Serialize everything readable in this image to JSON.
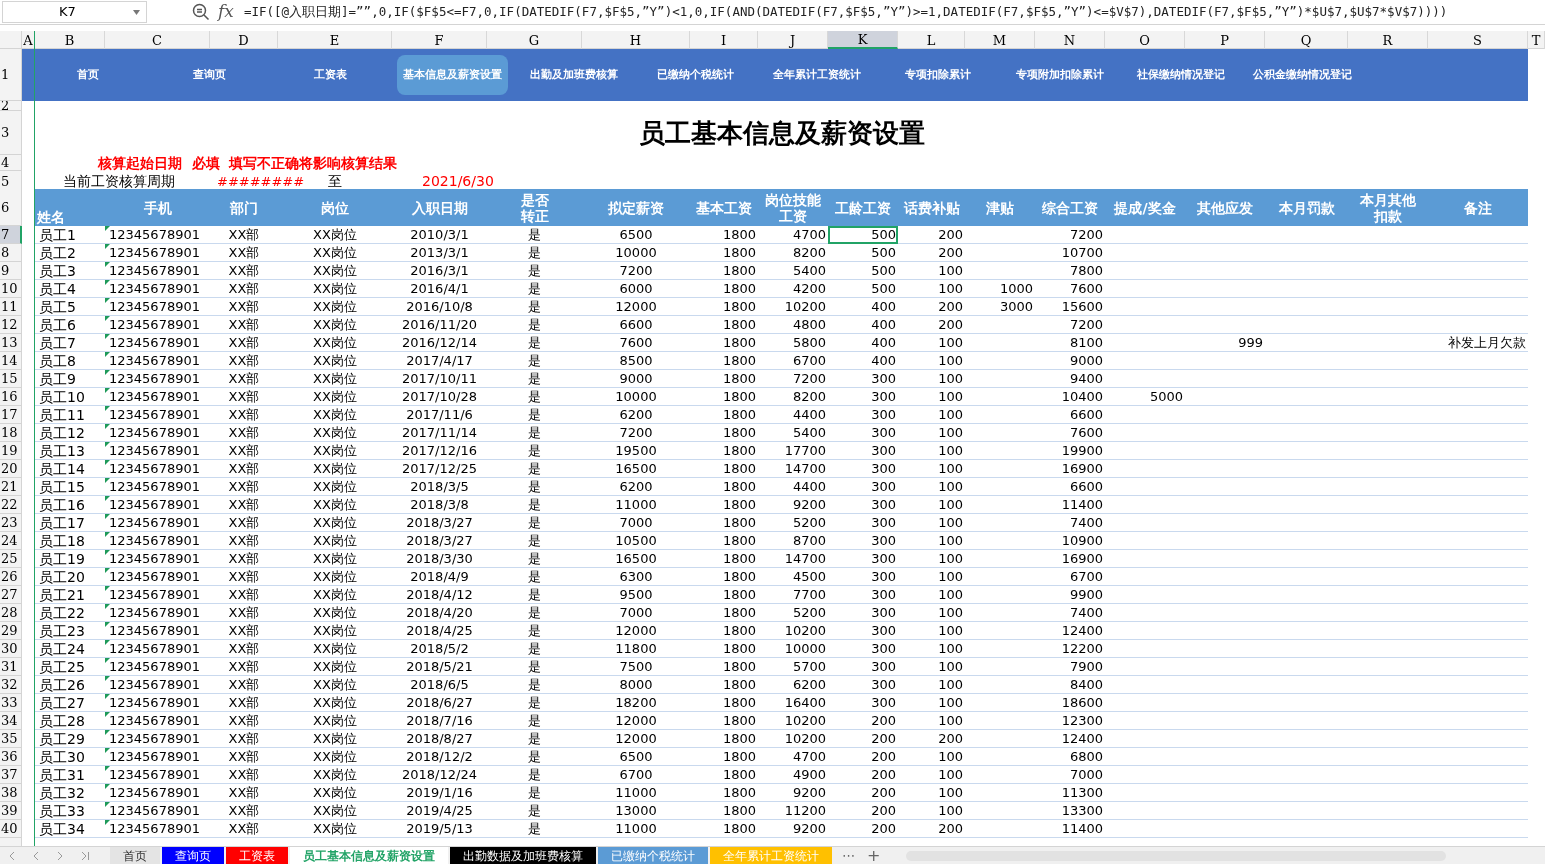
{
  "formula_bar": {
    "name_box": "K7",
    "fx_label": "fx",
    "formula": "=IF([@入职日期]=””,0,IF($F$5<=F7,0,IF(DATEDIF(F7,$F$5,”Y”)<1,0,IF(AND(DATEDIF(F7,$F$5,”Y”)>=1,DATEDIF(F7,$F$5,”Y”)<=$V$7),DATEDIF(F7,$F$5,”Y”)*$U$7,$U$7*$V$7))))"
  },
  "column_headers": [
    {
      "label": "A",
      "selected": false
    },
    {
      "label": "B",
      "selected": false
    },
    {
      "label": "C",
      "selected": false
    },
    {
      "label": "D",
      "selected": false
    },
    {
      "label": "E",
      "selected": false
    },
    {
      "label": "F",
      "selected": false
    },
    {
      "label": "G",
      "selected": false
    },
    {
      "label": "H",
      "selected": false
    },
    {
      "label": "I",
      "selected": false
    },
    {
      "label": "J",
      "selected": false
    },
    {
      "label": "K",
      "selected": true
    },
    {
      "label": "L",
      "selected": false
    },
    {
      "label": "M",
      "selected": false
    },
    {
      "label": "N",
      "selected": false
    },
    {
      "label": "O",
      "selected": false
    },
    {
      "label": "P",
      "selected": false
    },
    {
      "label": "Q",
      "selected": false
    },
    {
      "label": "R",
      "selected": false
    },
    {
      "label": "S",
      "selected": false
    },
    {
      "label": "T",
      "selected": false
    }
  ],
  "row_numbers": [
    {
      "label": "1",
      "selected": false
    },
    {
      "label": "2",
      "selected": false
    },
    {
      "label": "3",
      "selected": false
    },
    {
      "label": "4",
      "selected": false
    },
    {
      "label": "5",
      "selected": false
    },
    {
      "label": "6",
      "selected": false
    },
    {
      "label": "7",
      "selected": true
    },
    {
      "label": "8",
      "selected": false
    },
    {
      "label": "9",
      "selected": false
    },
    {
      "label": "10",
      "selected": false
    },
    {
      "label": "11",
      "selected": false
    },
    {
      "label": "12",
      "selected": false
    },
    {
      "label": "13",
      "selected": false
    },
    {
      "label": "14",
      "selected": false
    },
    {
      "label": "15",
      "selected": false
    },
    {
      "label": "16",
      "selected": false
    },
    {
      "label": "17",
      "selected": false
    },
    {
      "label": "18",
      "selected": false
    },
    {
      "label": "19",
      "selected": false
    },
    {
      "label": "20",
      "selected": false
    },
    {
      "label": "21",
      "selected": false
    },
    {
      "label": "22",
      "selected": false
    },
    {
      "label": "23",
      "selected": false
    },
    {
      "label": "24",
      "selected": false
    },
    {
      "label": "25",
      "selected": false
    },
    {
      "label": "26",
      "selected": false
    },
    {
      "label": "27",
      "selected": false
    },
    {
      "label": "28",
      "selected": false
    },
    {
      "label": "29",
      "selected": false
    },
    {
      "label": "30",
      "selected": false
    },
    {
      "label": "31",
      "selected": false
    },
    {
      "label": "32",
      "selected": false
    },
    {
      "label": "33",
      "selected": false
    },
    {
      "label": "34",
      "selected": false
    },
    {
      "label": "35",
      "selected": false
    },
    {
      "label": "36",
      "selected": false
    },
    {
      "label": "37",
      "selected": false
    },
    {
      "label": "38",
      "selected": false
    },
    {
      "label": "39",
      "selected": false
    },
    {
      "label": "40",
      "selected": false
    }
  ],
  "nav_buttons": [
    {
      "label": "首页",
      "selected": false
    },
    {
      "label": "查询页",
      "selected": false
    },
    {
      "label": "工资表",
      "selected": false
    },
    {
      "label": "基本信息及薪资设置",
      "selected": true
    },
    {
      "label": "出勤及加班费核算",
      "selected": false
    },
    {
      "label": "已缴纳个税统计",
      "selected": false
    },
    {
      "label": "全年累计工资统计",
      "selected": false
    },
    {
      "label": "专项扣除累计",
      "selected": false
    },
    {
      "label": "专项附加扣除累计",
      "selected": false
    },
    {
      "label": "社保缴纳情况登记",
      "selected": false
    },
    {
      "label": "公积金缴纳情况登记",
      "selected": false
    }
  ],
  "title": "员工基本信息及薪资设置",
  "notice": "核算起始日期  必填  填写不正确将影响核算结果",
  "period": {
    "label": "当前工资核算周期",
    "start": "########",
    "separator": "至",
    "end": "2021/6/30"
  },
  "table": {
    "columns": [
      {
        "label": "姓名"
      },
      {
        "label": "手机",
        "number_as_text": true
      },
      {
        "label": "部门"
      },
      {
        "label": "岗位"
      },
      {
        "label": "入职日期"
      },
      {
        "label": "是否转正"
      },
      {
        "label": "拟定薪资"
      },
      {
        "label": "基本工资"
      },
      {
        "label": "岗位技能工资"
      },
      {
        "label": "工龄工资"
      },
      {
        "label": "话费补贴"
      },
      {
        "label": "津贴"
      },
      {
        "label": "综合工资"
      },
      {
        "label": "提成/奖金"
      },
      {
        "label": "其他应发"
      },
      {
        "label": "本月罚款"
      },
      {
        "label": "本月其他扣款"
      },
      {
        "label": "备注"
      }
    ],
    "rows": [
      {
        "cells": [
          "员工1",
          "12345678901",
          "XX部",
          "XX岗位",
          "2010/3/1",
          "是",
          "6500",
          "1800",
          "4700",
          "500",
          "200",
          null,
          "7200",
          null,
          null,
          null,
          null,
          null
        ]
      },
      {
        "cells": [
          "员工2",
          "12345678901",
          "XX部",
          "XX岗位",
          "2013/3/1",
          "是",
          "10000",
          "1800",
          "8200",
          "500",
          "200",
          null,
          "10700",
          null,
          null,
          null,
          null,
          null
        ]
      },
      {
        "cells": [
          "员工3",
          "12345678901",
          "XX部",
          "XX岗位",
          "2016/3/1",
          "是",
          "7200",
          "1800",
          "5400",
          "500",
          "100",
          null,
          "7800",
          null,
          null,
          null,
          null,
          null
        ]
      },
      {
        "cells": [
          "员工4",
          "12345678901",
          "XX部",
          "XX岗位",
          "2016/4/1",
          "是",
          "6000",
          "1800",
          "4200",
          "500",
          "100",
          "1000",
          "7600",
          null,
          null,
          null,
          null,
          null
        ]
      },
      {
        "cells": [
          "员工5",
          "12345678901",
          "XX部",
          "XX岗位",
          "2016/10/8",
          "是",
          "12000",
          "1800",
          "10200",
          "400",
          "200",
          "3000",
          "15600",
          null,
          null,
          null,
          null,
          null
        ]
      },
      {
        "cells": [
          "员工6",
          "12345678901",
          "XX部",
          "XX岗位",
          "2016/11/20",
          "是",
          "6600",
          "1800",
          "4800",
          "400",
          "200",
          null,
          "7200",
          null,
          null,
          null,
          null,
          null
        ]
      },
      {
        "cells": [
          "员工7",
          "12345678901",
          "XX部",
          "XX岗位",
          "2016/12/14",
          "是",
          "7600",
          "1800",
          "5800",
          "400",
          "100",
          null,
          "8100",
          null,
          "999",
          null,
          null,
          "补发上月欠款"
        ]
      },
      {
        "cells": [
          "员工8",
          "12345678901",
          "XX部",
          "XX岗位",
          "2017/4/17",
          "是",
          "8500",
          "1800",
          "6700",
          "400",
          "100",
          null,
          "9000",
          null,
          null,
          null,
          null,
          null
        ]
      },
      {
        "cells": [
          "员工9",
          "12345678901",
          "XX部",
          "XX岗位",
          "2017/10/11",
          "是",
          "9000",
          "1800",
          "7200",
          "300",
          "100",
          null,
          "9400",
          null,
          null,
          null,
          null,
          null
        ]
      },
      {
        "cells": [
          "员工10",
          "12345678901",
          "XX部",
          "XX岗位",
          "2017/10/28",
          "是",
          "10000",
          "1800",
          "8200",
          "300",
          "100",
          null,
          "10400",
          "5000",
          null,
          null,
          null,
          null
        ]
      },
      {
        "cells": [
          "员工11",
          "12345678901",
          "XX部",
          "XX岗位",
          "2017/11/6",
          "是",
          "6200",
          "1800",
          "4400",
          "300",
          "100",
          null,
          "6600",
          null,
          null,
          null,
          null,
          null
        ]
      },
      {
        "cells": [
          "员工12",
          "12345678901",
          "XX部",
          "XX岗位",
          "2017/11/14",
          "是",
          "7200",
          "1800",
          "5400",
          "300",
          "100",
          null,
          "7600",
          null,
          null,
          null,
          null,
          null
        ]
      },
      {
        "cells": [
          "员工13",
          "12345678901",
          "XX部",
          "XX岗位",
          "2017/12/16",
          "是",
          "19500",
          "1800",
          "17700",
          "300",
          "100",
          null,
          "19900",
          null,
          null,
          null,
          null,
          null
        ]
      },
      {
        "cells": [
          "员工14",
          "12345678901",
          "XX部",
          "XX岗位",
          "2017/12/25",
          "是",
          "16500",
          "1800",
          "14700",
          "300",
          "100",
          null,
          "16900",
          null,
          null,
          null,
          null,
          null
        ]
      },
      {
        "cells": [
          "员工15",
          "12345678901",
          "XX部",
          "XX岗位",
          "2018/3/5",
          "是",
          "6200",
          "1800",
          "4400",
          "300",
          "100",
          null,
          "6600",
          null,
          null,
          null,
          null,
          null
        ]
      },
      {
        "cells": [
          "员工16",
          "12345678901",
          "XX部",
          "XX岗位",
          "2018/3/8",
          "是",
          "11000",
          "1800",
          "9200",
          "300",
          "100",
          null,
          "11400",
          null,
          null,
          null,
          null,
          null
        ]
      },
      {
        "cells": [
          "员工17",
          "12345678901",
          "XX部",
          "XX岗位",
          "2018/3/27",
          "是",
          "7000",
          "1800",
          "5200",
          "300",
          "100",
          null,
          "7400",
          null,
          null,
          null,
          null,
          null
        ]
      },
      {
        "cells": [
          "员工18",
          "12345678901",
          "XX部",
          "XX岗位",
          "2018/3/27",
          "是",
          "10500",
          "1800",
          "8700",
          "300",
          "100",
          null,
          "10900",
          null,
          null,
          null,
          null,
          null
        ]
      },
      {
        "cells": [
          "员工19",
          "12345678901",
          "XX部",
          "XX岗位",
          "2018/3/30",
          "是",
          "16500",
          "1800",
          "14700",
          "300",
          "100",
          null,
          "16900",
          null,
          null,
          null,
          null,
          null
        ]
      },
      {
        "cells": [
          "员工20",
          "12345678901",
          "XX部",
          "XX岗位",
          "2018/4/9",
          "是",
          "6300",
          "1800",
          "4500",
          "300",
          "100",
          null,
          "6700",
          null,
          null,
          null,
          null,
          null
        ]
      },
      {
        "cells": [
          "员工21",
          "12345678901",
          "XX部",
          "XX岗位",
          "2018/4/12",
          "是",
          "9500",
          "1800",
          "7700",
          "300",
          "100",
          null,
          "9900",
          null,
          null,
          null,
          null,
          null
        ]
      },
      {
        "cells": [
          "员工22",
          "12345678901",
          "XX部",
          "XX岗位",
          "2018/4/20",
          "是",
          "7000",
          "1800",
          "5200",
          "300",
          "100",
          null,
          "7400",
          null,
          null,
          null,
          null,
          null
        ]
      },
      {
        "cells": [
          "员工23",
          "12345678901",
          "XX部",
          "XX岗位",
          "2018/4/25",
          "是",
          "12000",
          "1800",
          "10200",
          "300",
          "100",
          null,
          "12400",
          null,
          null,
          null,
          null,
          null
        ]
      },
      {
        "cells": [
          "员工24",
          "12345678901",
          "XX部",
          "XX岗位",
          "2018/5/2",
          "是",
          "11800",
          "1800",
          "10000",
          "300",
          "100",
          null,
          "12200",
          null,
          null,
          null,
          null,
          null
        ]
      },
      {
        "cells": [
          "员工25",
          "12345678901",
          "XX部",
          "XX岗位",
          "2018/5/21",
          "是",
          "7500",
          "1800",
          "5700",
          "300",
          "100",
          null,
          "7900",
          null,
          null,
          null,
          null,
          null
        ]
      },
      {
        "cells": [
          "员工26",
          "12345678901",
          "XX部",
          "XX岗位",
          "2018/6/5",
          "是",
          "8000",
          "1800",
          "6200",
          "300",
          "100",
          null,
          "8400",
          null,
          null,
          null,
          null,
          null
        ]
      },
      {
        "cells": [
          "员工27",
          "12345678901",
          "XX部",
          "XX岗位",
          "2018/6/27",
          "是",
          "18200",
          "1800",
          "16400",
          "300",
          "100",
          null,
          "18600",
          null,
          null,
          null,
          null,
          null
        ]
      },
      {
        "cells": [
          "员工28",
          "12345678901",
          "XX部",
          "XX岗位",
          "2018/7/16",
          "是",
          "12000",
          "1800",
          "10200",
          "200",
          "100",
          null,
          "12300",
          null,
          null,
          null,
          null,
          null
        ]
      },
      {
        "cells": [
          "员工29",
          "12345678901",
          "XX部",
          "XX岗位",
          "2018/8/27",
          "是",
          "12000",
          "1800",
          "10200",
          "200",
          "200",
          null,
          "12400",
          null,
          null,
          null,
          null,
          null
        ]
      },
      {
        "cells": [
          "员工30",
          "12345678901",
          "XX部",
          "XX岗位",
          "2018/12/2",
          "是",
          "6500",
          "1800",
          "4700",
          "200",
          "100",
          null,
          "6800",
          null,
          null,
          null,
          null,
          null
        ]
      },
      {
        "cells": [
          "员工31",
          "12345678901",
          "XX部",
          "XX岗位",
          "2018/12/24",
          "是",
          "6700",
          "1800",
          "4900",
          "200",
          "100",
          null,
          "7000",
          null,
          null,
          null,
          null,
          null
        ]
      },
      {
        "cells": [
          "员工32",
          "12345678901",
          "XX部",
          "XX岗位",
          "2019/1/16",
          "是",
          "11000",
          "1800",
          "9200",
          "200",
          "100",
          null,
          "11300",
          null,
          null,
          null,
          null,
          null
        ]
      },
      {
        "cells": [
          "员工33",
          "12345678901",
          "XX部",
          "XX岗位",
          "2019/4/25",
          "是",
          "13000",
          "1800",
          "11200",
          "200",
          "100",
          null,
          "13300",
          null,
          null,
          null,
          null,
          null
        ]
      },
      {
        "cells": [
          "员工34",
          "12345678901",
          "XX部",
          "XX岗位",
          "2019/5/13",
          "是",
          "11000",
          "1800",
          "9200",
          "200",
          "200",
          null,
          "11400",
          null,
          null,
          null,
          null,
          null
        ]
      }
    ]
  },
  "sheet_tabs": [
    {
      "label": "首页",
      "selected": false
    },
    {
      "label": "查询页",
      "selected": false,
      "color": "#0000ff"
    },
    {
      "label": "工资表",
      "selected": false,
      "color": "#ff0000"
    },
    {
      "label": "员工基本信息及薪资设置",
      "selected": true
    },
    {
      "label": "出勤数据及加班费核算",
      "selected": false,
      "color": "#000000"
    },
    {
      "label": "已缴纳个税统计",
      "selected": false,
      "color": "#5b9bd5"
    },
    {
      "label": "全年累计工资统计",
      "selected": false,
      "color": "#ffc000"
    }
  ],
  "tab_overflow": "⋯",
  "add_tab": "+"
}
